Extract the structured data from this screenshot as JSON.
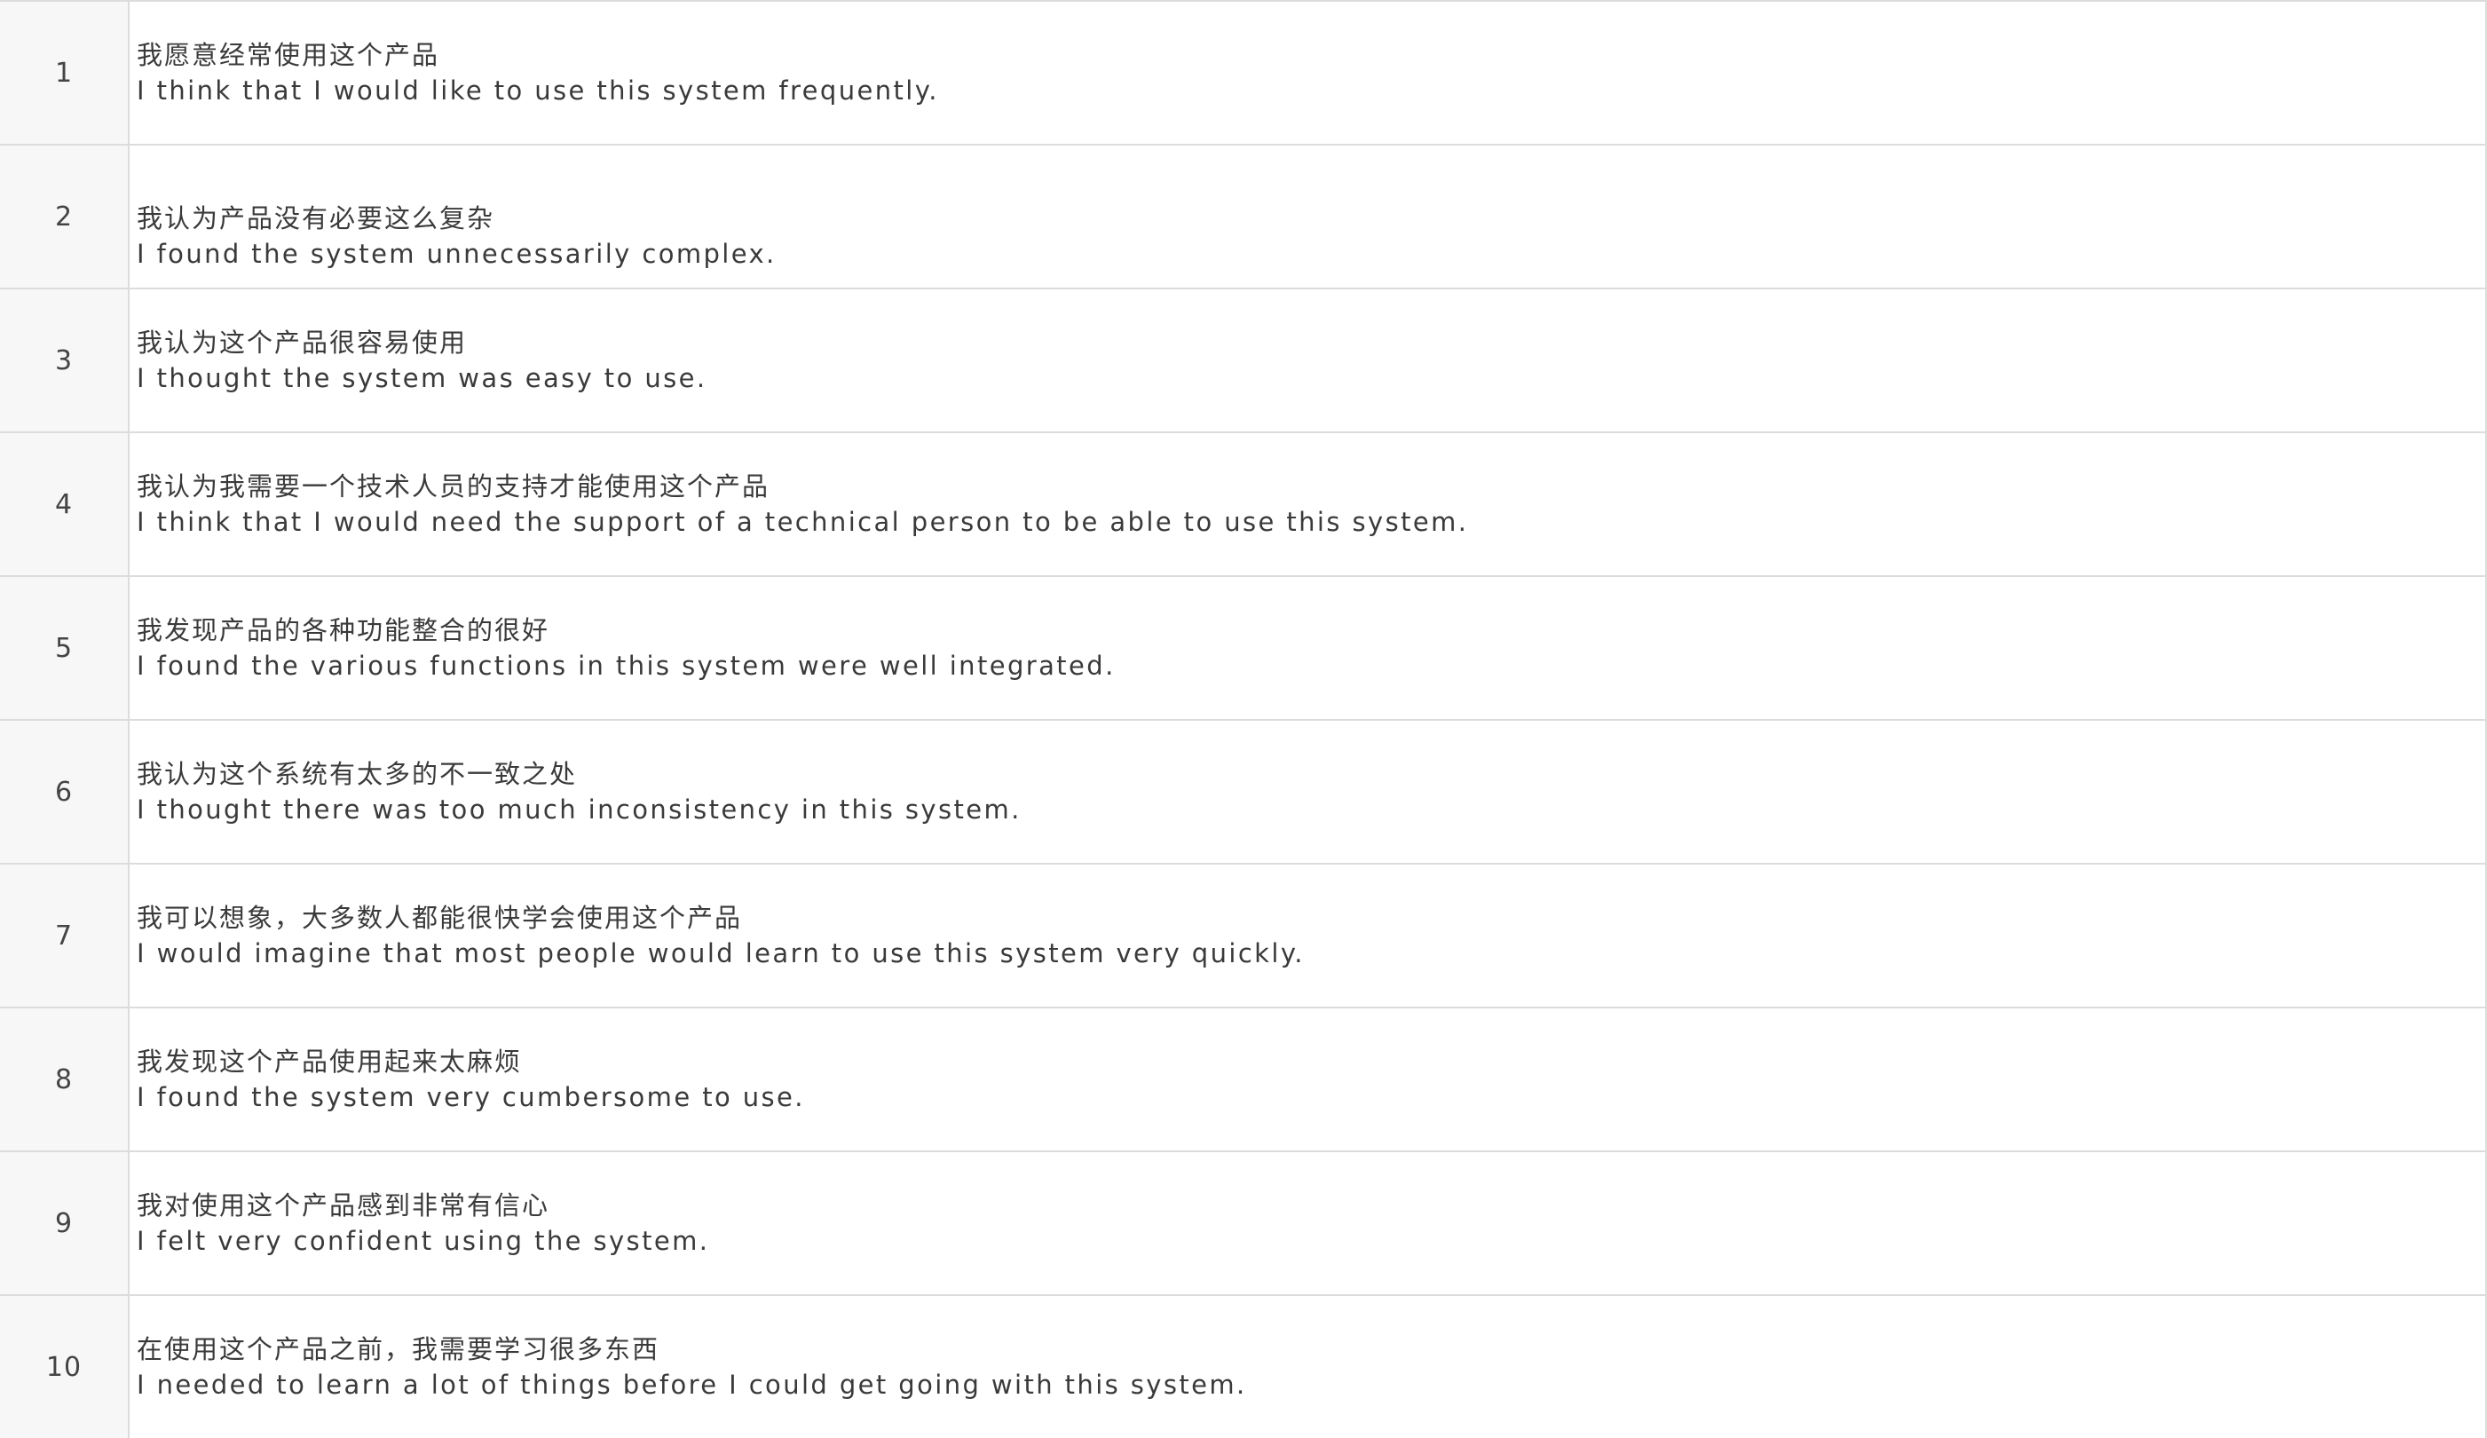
{
  "table": {
    "rows": [
      {
        "num": "1",
        "zh": "我愿意经常使用这个产品",
        "en": "I think that I would like to use this system frequently."
      },
      {
        "num": "2",
        "zh": "我认为产品没有必要这么复杂",
        "en": "I found the system unnecessarily complex."
      },
      {
        "num": "3",
        "zh": "我认为这个产品很容易使用",
        "en": "I thought the system was easy to use."
      },
      {
        "num": "4",
        "zh": "我认为我需要一个技术人员的支持才能使用这个产品",
        "en": "I think that I would need the support of a technical person to be able to use this system."
      },
      {
        "num": "5",
        "zh": "我发现产品的各种功能整合的很好",
        "en": "I found the various functions in this system were well integrated."
      },
      {
        "num": "6",
        "zh": "我认为这个系统有太多的不一致之处",
        "en": "I thought there was too much inconsistency in this system."
      },
      {
        "num": "7",
        "zh": "我可以想象，大多数人都能很快学会使用这个产品",
        "en": "I would imagine that most people would learn to use this system very quickly."
      },
      {
        "num": "8",
        "zh": "我发现这个产品使用起来太麻烦",
        "en": "I found the system very cumbersome to use."
      },
      {
        "num": "9",
        "zh": "我对使用这个产品感到非常有信心",
        "en": "I felt very confident using the system."
      },
      {
        "num": "10",
        "zh": "在使用这个产品之前，我需要学习很多东西",
        "en": "I needed to learn a lot of things before I could get going with this system."
      }
    ]
  },
  "colors": {
    "grid_line": "#dcdcdc",
    "number_column_bg": "#f7f7f7",
    "text": "#3a3a3a"
  }
}
